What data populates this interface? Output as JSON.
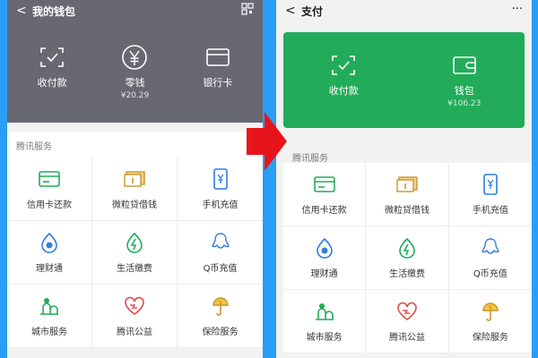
{
  "left": {
    "title": "我的钱包",
    "header": [
      {
        "label": "收付款",
        "sub": "",
        "icon": "scan-icon"
      },
      {
        "label": "零钱",
        "sub": "¥20.29",
        "icon": "yuan-icon"
      },
      {
        "label": "银行卡",
        "sub": "",
        "icon": "bank-card-icon"
      }
    ],
    "section": "腾讯服务",
    "services": [
      {
        "label": "信用卡还款",
        "icon": "credit-card-icon"
      },
      {
        "label": "微粒贷借钱",
        "icon": "loan-icon"
      },
      {
        "label": "手机充值",
        "icon": "phone-icon"
      },
      {
        "label": "理财通",
        "icon": "wealth-icon"
      },
      {
        "label": "生活缴费",
        "icon": "utility-icon"
      },
      {
        "label": "Q币充值",
        "icon": "qcoin-icon"
      },
      {
        "label": "城市服务",
        "icon": "city-icon"
      },
      {
        "label": "腾讯公益",
        "icon": "charity-icon"
      },
      {
        "label": "保险服务",
        "icon": "insurance-icon"
      }
    ]
  },
  "right": {
    "title": "支付",
    "header": [
      {
        "label": "收付款",
        "sub": "",
        "icon": "scan-icon"
      },
      {
        "label": "钱包",
        "sub": "¥106.23",
        "icon": "wallet-icon"
      }
    ],
    "section": "腾讯服务",
    "services": [
      {
        "label": "信用卡还款",
        "icon": "credit-card-icon"
      },
      {
        "label": "微粒贷借钱",
        "icon": "loan-icon"
      },
      {
        "label": "手机充值",
        "icon": "phone-icon"
      },
      {
        "label": "理财通",
        "icon": "wealth-icon"
      },
      {
        "label": "生活缴费",
        "icon": "utility-icon"
      },
      {
        "label": "Q币充值",
        "icon": "qcoin-icon"
      },
      {
        "label": "城市服务",
        "icon": "city-icon"
      },
      {
        "label": "腾讯公益",
        "icon": "charity-icon"
      },
      {
        "label": "保险服务",
        "icon": "insurance-icon"
      }
    ]
  },
  "colors": {
    "background": "#2a9df4",
    "left_header": "#686872",
    "right_header": "#22ac5a",
    "arrow": "#e8141b",
    "icon_green": "#22ac5a",
    "icon_gold": "#c9962d",
    "icon_blue": "#2f7de1",
    "icon_red": "#e24c4c"
  }
}
